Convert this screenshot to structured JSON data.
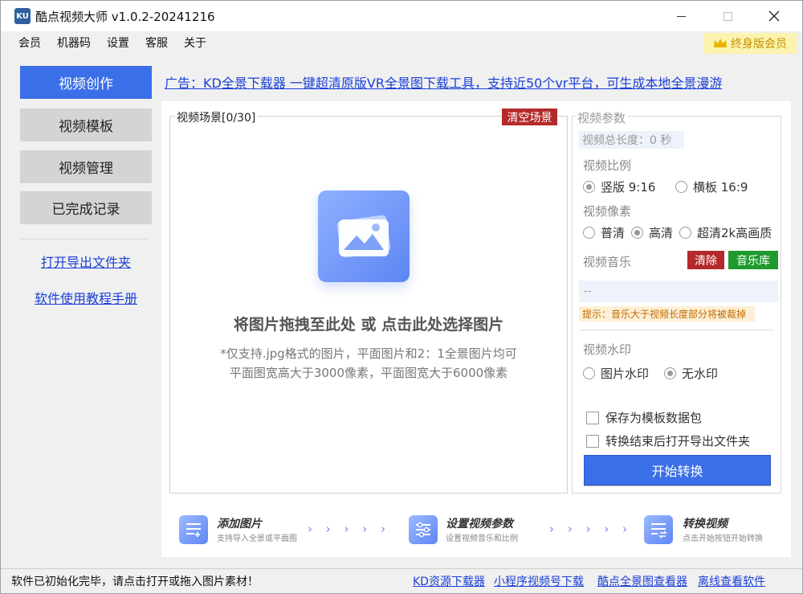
{
  "window": {
    "title": "酷点视频大师 v1.0.2-20241216",
    "icon_text": "KU"
  },
  "menu": {
    "items": [
      "会员",
      "机器码",
      "设置",
      "客服",
      "关于"
    ],
    "vip_label": "终身版会员"
  },
  "sidebar": {
    "buttons": [
      "视频创作",
      "视频模板",
      "视频管理",
      "已完成记录"
    ],
    "links": [
      "打开导出文件夹",
      "软件使用教程手册"
    ]
  },
  "ad": {
    "text": "广告：KD全景下载器 一键超清原版VR全景图下载工具，支持近50个vr平台，可生成本地全景漫游"
  },
  "scene": {
    "legend": "视频场景[0/30]",
    "clear_label": "清空场景",
    "drop_title": "将图片拖拽至此处 或 点击此处选择图片",
    "note_line1": "*仅支持.jpg格式的图片，平面图片和2：1全景图片均可",
    "note_line2": "平面图宽高大于3000像素，平面图宽大于6000像素"
  },
  "params": {
    "legend": "视频参数",
    "length_text": "视频总长度：0 秒",
    "ratio_label": "视频比例",
    "ratio_options": [
      {
        "label": "竖版 9:16",
        "selected": true
      },
      {
        "label": "横板 16:9",
        "selected": false
      }
    ],
    "pixel_label": "视频像素",
    "pixel_options": [
      {
        "label": "普清",
        "selected": false
      },
      {
        "label": "高清",
        "selected": true
      },
      {
        "label": "超清2k高画质",
        "selected": false
      }
    ],
    "music_label": "视频音乐",
    "music_clear": "清除",
    "music_lib": "音乐库",
    "music_value": "--",
    "music_tip": "提示：音乐大于视频长度部分将被裁掉",
    "watermark_label": "视频水印",
    "watermark_options": [
      {
        "label": "图片水印",
        "selected": false
      },
      {
        "label": "无水印",
        "selected": true
      }
    ],
    "checkboxes": [
      {
        "label": "保存为模板数据包",
        "checked": false
      },
      {
        "label": "转换结束后打开导出文件夹",
        "checked": false
      }
    ],
    "start_label": "开始转换"
  },
  "steps": [
    {
      "title": "添加图片",
      "subtitle": "支持导入全景或平面图"
    },
    {
      "title": "设置视频参数",
      "subtitle": "设置视频音乐和比例"
    },
    {
      "title": "转换视频",
      "subtitle": "点击开始按钮开始转换"
    }
  ],
  "chevrons": "› › › › ›",
  "status": {
    "text": "软件已初始化完毕，请点击打开或拖入图片素材！",
    "links": [
      "KD资源下载器",
      "小程序视频号下载",
      "酷点全景图查看器",
      "离线查看软件"
    ]
  },
  "colors": {
    "accent": "#3b6fe8",
    "danger": "#b42a2a",
    "success": "#1f9a2e",
    "link": "#1a3fd6",
    "vip_bg": "#fbf3ae"
  }
}
